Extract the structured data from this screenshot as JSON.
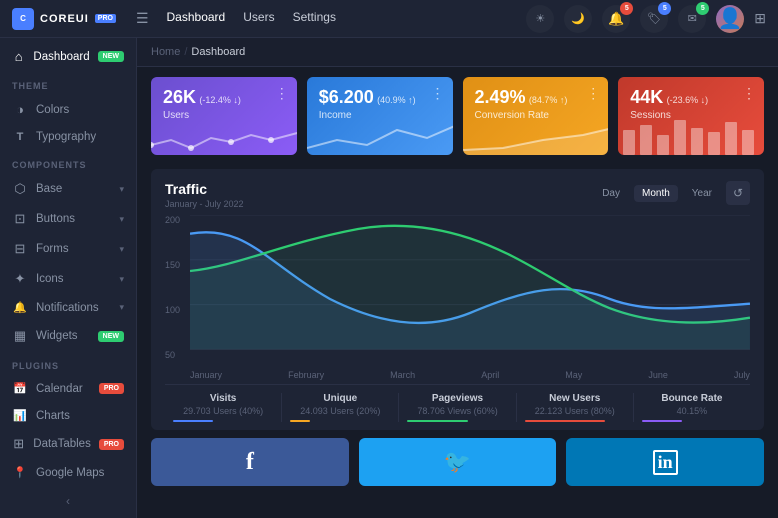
{
  "app": {
    "logo_text": "COREUI",
    "logo_pro": "PRO",
    "logo_icon": "C"
  },
  "topnav": {
    "hamburger_icon": "☰",
    "links": [
      {
        "label": "Dashboard",
        "active": true
      },
      {
        "label": "Users",
        "active": false
      },
      {
        "label": "Settings",
        "active": false
      }
    ],
    "sun_icon": "☀",
    "moon_icon": "🌙",
    "bell_icon": "🔔",
    "message_icon": "✉",
    "tag_icon": "🏷",
    "bell_badge": "5",
    "tag_badge": "5",
    "msg_badge": "5",
    "grid_icon": "⊞",
    "avatar_text": ""
  },
  "breadcrumb": {
    "home": "Home",
    "sep": "/",
    "current": "Dashboard"
  },
  "sidebar": {
    "dashboard_label": "Dashboard",
    "dashboard_badge": "NEW",
    "theme_section": "ThemE",
    "theme_items": [
      {
        "icon": "◑",
        "label": "Colors"
      },
      {
        "icon": "T",
        "label": "Typography"
      }
    ],
    "components_section": "COMPONENTS",
    "components_items": [
      {
        "icon": "⬡",
        "label": "Base",
        "arrow": "▾"
      },
      {
        "icon": "⊡",
        "label": "Buttons",
        "arrow": "▾"
      },
      {
        "icon": "⊟",
        "label": "Forms",
        "arrow": "▾"
      },
      {
        "icon": "✦",
        "label": "Icons",
        "arrow": "▾"
      },
      {
        "icon": "🔔",
        "label": "Notifications",
        "arrow": "▾"
      },
      {
        "icon": "▦",
        "label": "Widgets",
        "badge": "NEW"
      }
    ],
    "plugins_section": "PLUGINS",
    "plugins_items": [
      {
        "icon": "📅",
        "label": "Calendar",
        "badge": "PRO",
        "badge_type": "pro"
      },
      {
        "icon": "📊",
        "label": "Charts"
      },
      {
        "icon": "⊞",
        "label": "DataTables",
        "badge": "PRO",
        "badge_type": "pro"
      },
      {
        "icon": "📍",
        "label": "Google Maps"
      }
    ],
    "collapse_icon": "‹"
  },
  "stats": [
    {
      "value": "26K",
      "change": "(-12.4% ↓)",
      "label": "Users",
      "color": "purple"
    },
    {
      "value": "$6.200",
      "change": "(40.9% ↑)",
      "label": "Income",
      "color": "blue"
    },
    {
      "value": "2.49%",
      "change": "(84.7% ↑)",
      "label": "Conversion Rate",
      "color": "orange"
    },
    {
      "value": "44K",
      "change": "(-23.6% ↓)",
      "label": "Sessions",
      "color": "red"
    }
  ],
  "traffic": {
    "title": "Traffic",
    "subtitle": "January - July 2022",
    "time_buttons": [
      "Day",
      "Month",
      "Year"
    ],
    "active_time": "Month",
    "refresh_icon": "↺",
    "x_labels": [
      "January",
      "February",
      "March",
      "April",
      "May",
      "June",
      "July"
    ],
    "y_labels": [
      "200",
      "150",
      "100",
      "50"
    ],
    "stats": [
      {
        "label": "Visits",
        "value": "29.703 Users (40%)",
        "color": "#4a7fff"
      },
      {
        "label": "Unique",
        "value": "24.093 Users (20%)",
        "color": "#f5a623"
      },
      {
        "label": "Pageviews",
        "value": "78.706 Views (60%)",
        "color": "#2ecc71"
      },
      {
        "label": "New Users",
        "value": "22.123 Users (80%)",
        "color": "#e74c3c"
      },
      {
        "label": "Bounce Rate",
        "value": "40.15%",
        "color": "#8b5cf6"
      }
    ]
  },
  "social": [
    {
      "name": "Facebook",
      "icon": "f",
      "color": "facebook"
    },
    {
      "name": "Twitter",
      "icon": "🐦",
      "color": "twitter"
    },
    {
      "name": "LinkedIn",
      "icon": "in",
      "color": "linkedin"
    }
  ]
}
